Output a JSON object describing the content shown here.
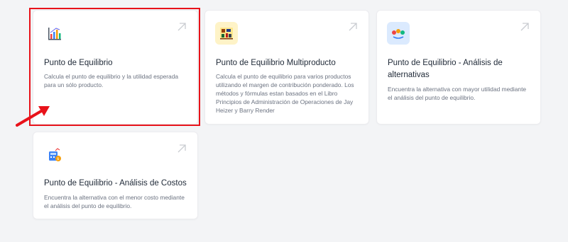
{
  "cards": [
    {
      "title": "Punto de Equilibrio",
      "description": "Calcula el punto de equilibrio y la utilidad esperada para un sólo producto.",
      "icon": "bar-chart-icon"
    },
    {
      "title": "Punto de Equilibrio Multiproducto",
      "description": "Calcula el punto de equilibrio para varios productos utilizando el margen de contribución ponderado. Los métodos y fórmulas estan basados en el Libro Principios de Administración de Operaciones de Jay Heizer y Barry Render",
      "icon": "products-icon"
    },
    {
      "title": "Punto de Equilibrio - Análisis de alternativas",
      "description": "Encuentra la alternativa con mayor utilidad mediante el análisis del punto de equilibrio.",
      "icon": "alternatives-icon"
    },
    {
      "title": "Punto de Equilibrio - Análisis de Costos",
      "description": "Encuentra la alternativa con el menor costo mediante el análisis del punto de equilibrio.",
      "icon": "cost-analysis-icon"
    }
  ],
  "annotation": {
    "highlight_color": "#e8121a"
  },
  "colors": {
    "background": "#f3f4f6",
    "card": "#ffffff",
    "title": "#1f2937",
    "description": "#6b7280",
    "open_arrow": "#c9ccd1"
  }
}
